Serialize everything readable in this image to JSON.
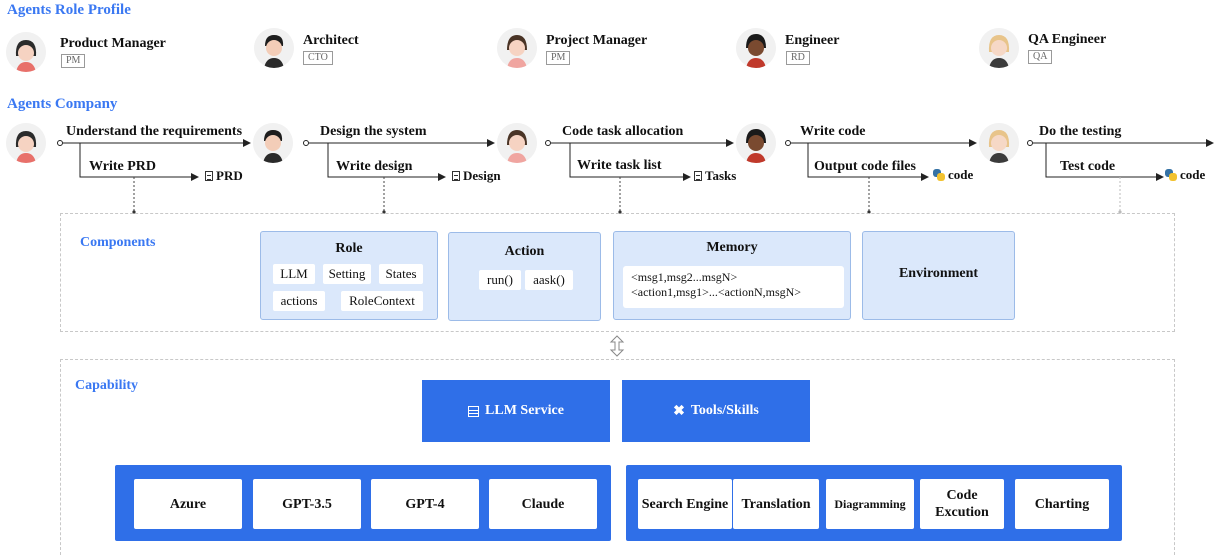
{
  "profile": {
    "title": "Agents Role Profile",
    "roles": [
      {
        "name": "Product Manager",
        "tag": "PM"
      },
      {
        "name": "Architect",
        "tag": "CTO"
      },
      {
        "name": "Project Manager",
        "tag": "PM"
      },
      {
        "name": "Engineer",
        "tag": "RD"
      },
      {
        "name": "QA Engineer",
        "tag": "QA"
      }
    ]
  },
  "company": {
    "title": "Agents Company",
    "steps": [
      {
        "main": "Understand the requirements",
        "sub": "Write PRD",
        "output": "PRD",
        "icon": "document-icon"
      },
      {
        "main": "Design the system",
        "sub": "Write design",
        "output": "Design",
        "icon": "document-icon"
      },
      {
        "main": "Code task allocation",
        "sub": "Write task list",
        "output": "Tasks",
        "icon": "document-icon"
      },
      {
        "main": "Write code",
        "sub": "Output code files",
        "output": "code",
        "icon": "python-icon"
      },
      {
        "main": "Do the testing",
        "sub": "Test code",
        "output": "code",
        "icon": "python-icon"
      }
    ]
  },
  "components": {
    "title": "Components",
    "role": {
      "title": "Role",
      "chips": [
        "LLM",
        "Setting",
        "States",
        "actions",
        "RoleContext"
      ]
    },
    "action": {
      "title": "Action",
      "chips": [
        "run()",
        "aask()"
      ]
    },
    "memory": {
      "title": "Memory",
      "line1": "<msg1,msg2...msgN>",
      "line2": "<action1,msg1>...<actionN,msgN>"
    },
    "environment": {
      "title": "Environment"
    }
  },
  "capability": {
    "title": "Capability",
    "llm_service": "LLM Service",
    "tools_skills": "Tools/Skills",
    "llm_items": [
      "Azure",
      "GPT-3.5",
      "GPT-4",
      "Claude"
    ],
    "tool_items": [
      "Search Engine",
      "Translation",
      "Diagramming",
      "Code Excution",
      "Charting"
    ]
  },
  "colors": {
    "accent": "#3a78f2",
    "panel_blue": "#2f6fe8",
    "card_blue": "#dbe8fb"
  }
}
